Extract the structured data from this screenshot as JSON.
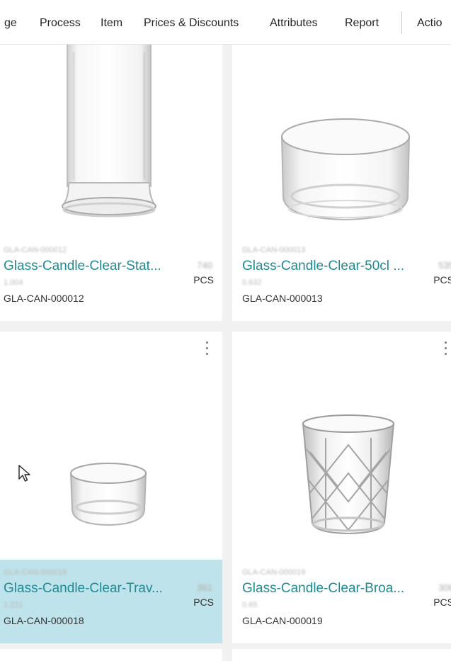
{
  "toolbar": {
    "items": [
      "ge",
      "Process",
      "Item",
      "Prices & Discounts",
      "Attributes",
      "Report",
      "Actio"
    ]
  },
  "tiles": [
    {
      "code_top": "GLA-CAN-000012",
      "description": "Glass-Candle-Clear-Stat...",
      "sub": "1.004",
      "qty": "740",
      "uom": "PCS",
      "code": "GLA-CAN-000012",
      "image_icon": "tall-glass-cylinder-image",
      "selected": false
    },
    {
      "code_top": "GLA-CAN-000013",
      "description": "Glass-Candle-Clear-50cl ...",
      "sub": "0.632",
      "qty": "535",
      "uom": "PCS",
      "code": "GLA-CAN-000013",
      "image_icon": "wide-glass-bowl-image",
      "selected": false
    },
    {
      "code_top": "GLA-CAN-000018",
      "description": "Glass-Candle-Clear-Trav...",
      "sub": "1.221",
      "qty": "361",
      "uom": "PCS",
      "code": "GLA-CAN-000018",
      "image_icon": "small-glass-votive-image",
      "selected": true
    },
    {
      "code_top": "GLA-CAN-000019",
      "description": "Glass-Candle-Clear-Broa...",
      "sub": "0.65",
      "qty": "308",
      "uom": "PCS",
      "code": "GLA-CAN-000019",
      "image_icon": "cut-crystal-tumbler-image",
      "selected": false
    }
  ],
  "colors": {
    "link": "#1f8a93",
    "selected_bg": "#bfe3ea",
    "page_bg": "#f1f1f1"
  }
}
